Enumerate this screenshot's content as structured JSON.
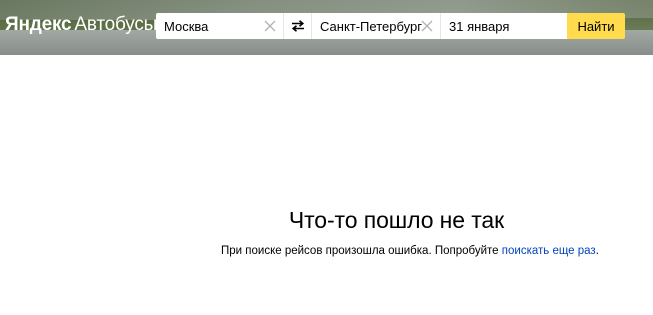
{
  "header": {
    "logo_brand": "Яндекс",
    "logo_service": "Автобусы"
  },
  "search": {
    "from_value": "Москва",
    "to_value": "Санкт-Петербург",
    "date_value": "31 января",
    "submit_label": "Найти"
  },
  "error": {
    "title": "Что-то пошло не так",
    "message": "При поиске рейсов произошла ошибка. Попробуйте ",
    "retry_link": "поискать еще раз",
    "message_end": "."
  },
  "colors": {
    "accent_button": "#ffdb4d",
    "link": "#0044bb"
  },
  "icons": {
    "clear": "close-icon",
    "swap": "swap-arrows-icon"
  }
}
